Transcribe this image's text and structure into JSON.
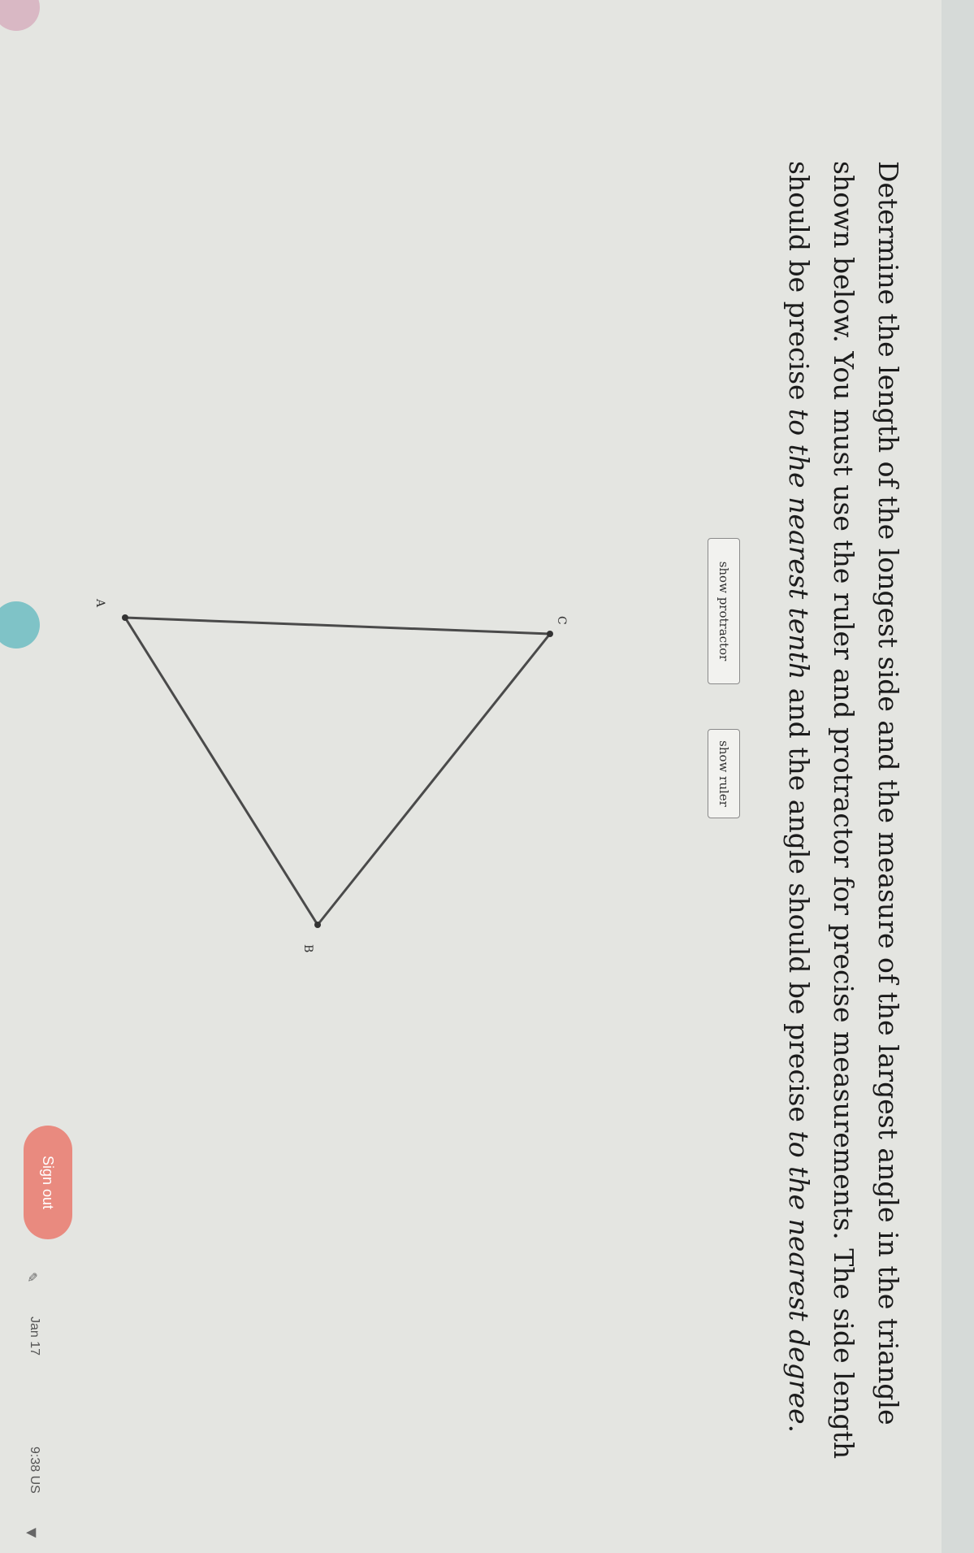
{
  "question": {
    "part1": "Determine the length of the longest side and the measure of the largest angle in the triangle shown below. You must use the ruler and protractor for precise measurements. The side length should be precise ",
    "emph1": "to the nearest tenth",
    "part2": " and the angle should be precise ",
    "emph2": "to the nearest degree",
    "part3": "."
  },
  "tools": {
    "protractor_label": "show protractor",
    "ruler_label": "show ruler"
  },
  "triangle": {
    "labels": {
      "A": "A",
      "B": "B",
      "C": "C"
    },
    "stroke_color": "#4a4a4a"
  },
  "shelf": {
    "sign_out_label": "Sign out",
    "date": "Jan 17",
    "time": "9:38 US",
    "accent_color": "#e98a7f"
  }
}
